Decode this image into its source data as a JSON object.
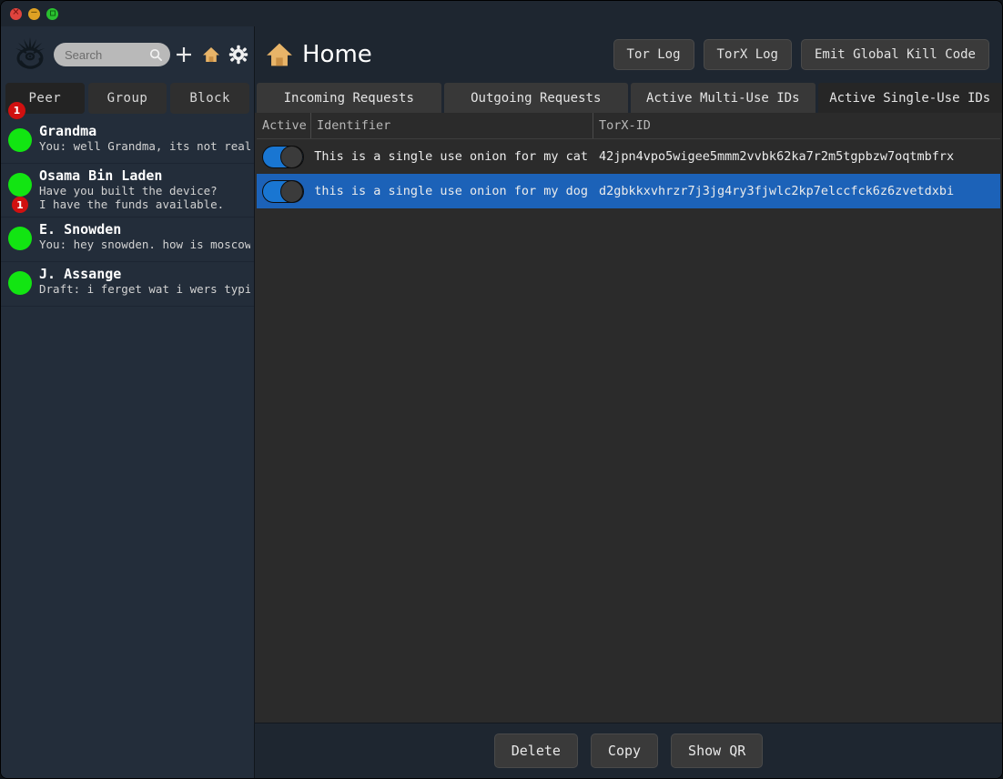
{
  "window": {
    "controls": {
      "close": "✕",
      "minimize": "−",
      "maximize": "□"
    }
  },
  "sidebar": {
    "logo_icon": "octopus-logo-icon",
    "search": {
      "value": "",
      "placeholder": "Search"
    },
    "icons": [
      {
        "name": "add-icon",
        "glyph": "+"
      },
      {
        "name": "home-icon",
        "glyph": "⌂"
      },
      {
        "name": "settings-gear-icon",
        "glyph": "⚙"
      }
    ],
    "segments": [
      {
        "label": "Peer",
        "active": true,
        "badge": "1"
      },
      {
        "label": "Group",
        "active": false,
        "badge": ""
      },
      {
        "label": "Block",
        "active": false,
        "badge": ""
      }
    ],
    "peers": [
      {
        "name": "Grandma",
        "preview": "You: well Grandma, its not really",
        "preview2": "",
        "status_color": "#12e512",
        "badge": ""
      },
      {
        "name": "Osama Bin Laden",
        "preview": "Have you built the device?",
        "preview2": "I have the funds available.",
        "status_color": "#12e512",
        "badge": "1"
      },
      {
        "name": "E. Snowden",
        "preview": "You: hey snowden. how is moscow?",
        "preview2": "",
        "status_color": "#12e512",
        "badge": ""
      },
      {
        "name": "J. Assange",
        "preview": "Draft: i ferget wat i wers typing",
        "preview2": "",
        "status_color": "#12e512",
        "badge": ""
      }
    ]
  },
  "header": {
    "home_icon": "home-icon",
    "title": "Home",
    "buttons": [
      {
        "label": "Tor Log"
      },
      {
        "label": "TorX Log"
      },
      {
        "label": "Emit Global Kill Code"
      }
    ]
  },
  "tabs": [
    {
      "label": "Incoming Requests",
      "selected": false
    },
    {
      "label": "Outgoing Requests",
      "selected": false
    },
    {
      "label": "Active Multi-Use IDs",
      "selected": false
    },
    {
      "label": "Active Single-Use IDs",
      "selected": true
    }
  ],
  "table": {
    "columns": [
      "Active",
      "Identifier",
      "TorX-ID"
    ],
    "rows": [
      {
        "active": true,
        "identifier": "This is a single use onion for my cat",
        "torx_id": "42jpn4vpo5wigee5mmm2vvbk62ka7r2m5tgpbzw7oqtmbfrx",
        "selected": false
      },
      {
        "active": true,
        "identifier": "this is a single use onion for my dog",
        "torx_id": "d2gbkkxvhrzr7j3jg4ry3fjwlc2kp7elccfck6z6zvetdxbi",
        "selected": true
      }
    ]
  },
  "footer": {
    "buttons": [
      {
        "label": "Delete"
      },
      {
        "label": "Copy"
      },
      {
        "label": "Show QR"
      }
    ]
  },
  "colors": {
    "accent_blue": "#1c62b8",
    "toggle_on": "#1976d2",
    "status_online": "#12e512",
    "badge_red": "#d01010",
    "sidebar_bg": "#232d3a",
    "content_bg": "#2b2b2b",
    "chrome_bg": "#1e2630",
    "home_icon_color": "#e8b468"
  }
}
